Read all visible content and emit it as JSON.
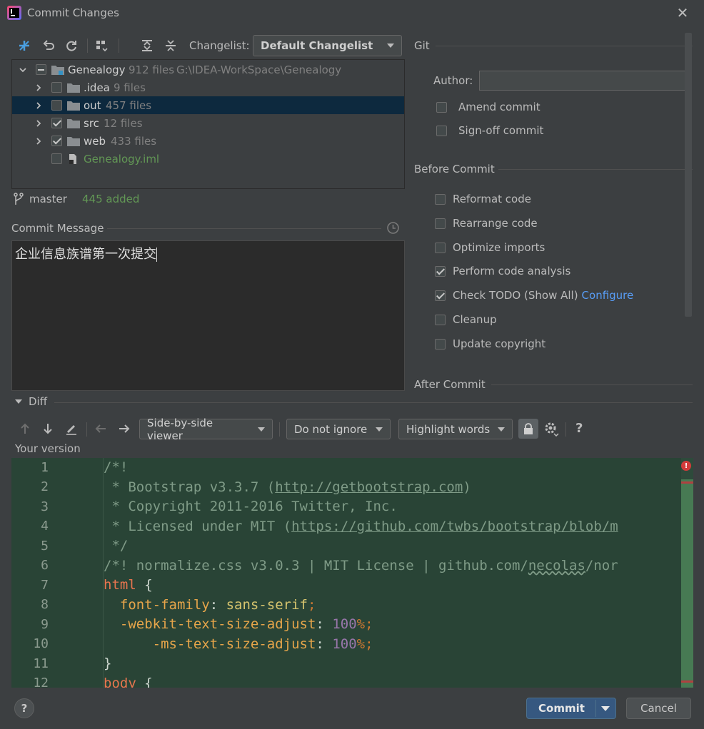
{
  "window": {
    "title": "Commit Changes"
  },
  "toolbar": {
    "changelist_label": "Changelist:",
    "changelist_value": "Default Changelist"
  },
  "tree": {
    "root": {
      "name": "Genealogy",
      "count": "912 files",
      "path": "G:\\IDEA-WorkSpace\\Genealogy"
    },
    "items": [
      {
        "name": ".idea",
        "count": "9 files"
      },
      {
        "name": "out",
        "count": "457 files"
      },
      {
        "name": "src",
        "count": "12 files"
      },
      {
        "name": "web",
        "count": "433 files"
      },
      {
        "name": "Genealogy.iml",
        "count": ""
      }
    ]
  },
  "status": {
    "branch": "master",
    "added": "445 added"
  },
  "commit_message": {
    "label": "Commit Message",
    "text": "企业信息族谱第一次提交"
  },
  "git": {
    "header": "Git",
    "author_label": "Author:",
    "author_value": "",
    "amend": "Amend commit",
    "signoff": "Sign-off commit"
  },
  "before_commit": {
    "header": "Before Commit",
    "reformat": "Reformat code",
    "rearrange": "Rearrange code",
    "optimize": "Optimize imports",
    "analysis": "Perform code analysis",
    "todo": "Check TODO (Show All)",
    "configure": "Configure",
    "cleanup": "Cleanup",
    "copyright": "Update copyright"
  },
  "after_commit": {
    "header": "After Commit"
  },
  "diff": {
    "header": "Diff",
    "viewer": "Side-by-side viewer",
    "ignore": "Do not ignore",
    "highlight": "Highlight words",
    "version_label": "Your version",
    "help": "?"
  },
  "code": {
    "line_numbers": [
      "1",
      "2",
      "3",
      "4",
      "5",
      "6",
      "7",
      "8",
      "9",
      "10",
      "11",
      "12"
    ],
    "l1": "/*!",
    "l2a": " * Bootstrap v3.3.7 (",
    "l2url": "http://getbootstrap.com",
    "l2b": ")",
    "l3": " * Copyright 2011-2016 Twitter, Inc.",
    "l4a": " * Licensed under MIT (",
    "l4url": "https://github.com/twbs/bootstrap/blob/m",
    "l5": " */",
    "l6a": "/*! normalize.css v3.0.3 | MIT License | github.com/",
    "l6url": "necolas",
    "l6b": "/nor",
    "l7sel": "html",
    "l7b": " {",
    "l8p": "  font-family",
    "l8c": ": ",
    "l8v": "sans-serif",
    "l8s": ";",
    "l9p": "  -webkit-text-size-adjust",
    "l9c": ": ",
    "l9v": "100",
    "l9u": "%",
    "l9s": ";",
    "l10p": "      -ms-text-size-adjust",
    "l10c": ": ",
    "l10v": "100",
    "l10u": "%",
    "l10s": ";",
    "l11": "}",
    "l12sel": "body",
    "l12b": " {"
  },
  "buttons": {
    "commit": "Commit",
    "cancel": "Cancel",
    "help": "?"
  },
  "colors": {
    "accent": "#365880",
    "link": "#589df6",
    "added": "#629755",
    "editor_bg": "#294436",
    "selection": "#0d293e"
  }
}
